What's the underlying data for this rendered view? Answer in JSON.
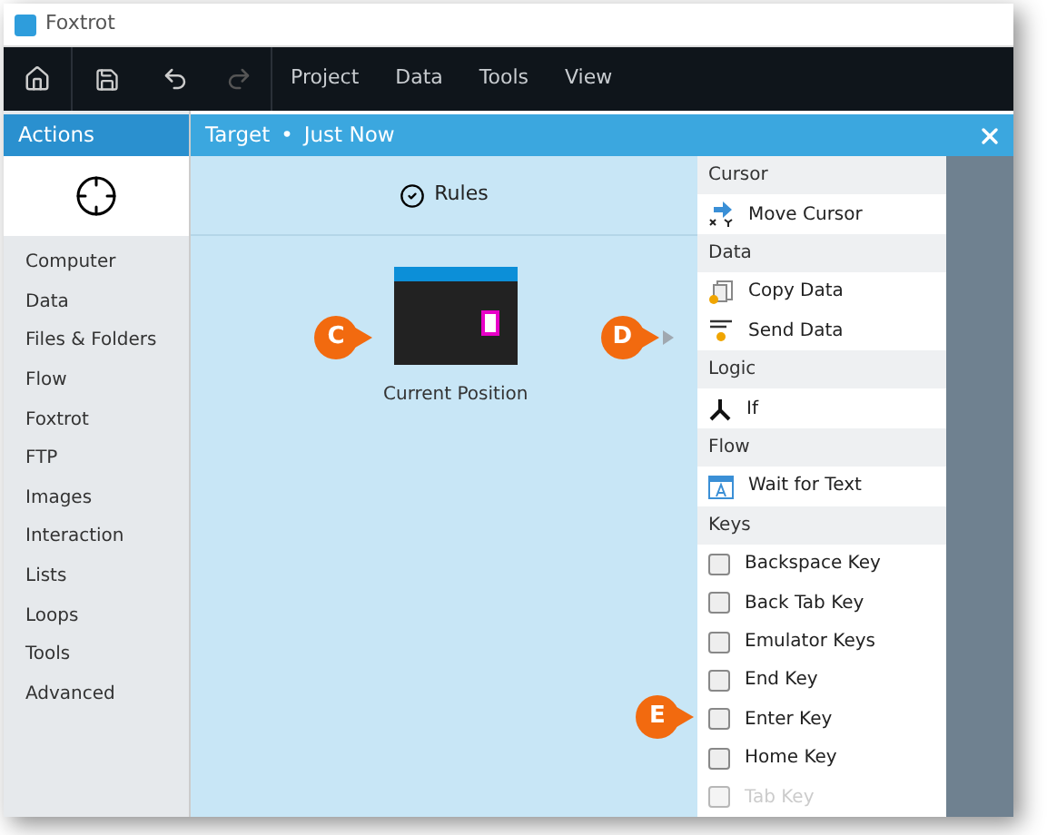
{
  "window": {
    "title": "Foxtrot"
  },
  "toolbar": {
    "menu": [
      "Project",
      "Data",
      "Tools",
      "View"
    ],
    "redo_disabled": true
  },
  "actions_panel": {
    "title": "Actions",
    "categories": [
      "Computer",
      "Data",
      "Files & Folders",
      "Flow",
      "Foxtrot",
      "FTP",
      "Images",
      "Interaction",
      "Lists",
      "Loops",
      "Tools",
      "Advanced"
    ]
  },
  "target_panel": {
    "title": "Target",
    "separator": "•",
    "time": "Just Now",
    "tab": "Rules",
    "node_label": "Current Position"
  },
  "action_list": [
    {
      "kind": "header",
      "label": "Cursor"
    },
    {
      "kind": "cursor",
      "label": "Move Cursor",
      "dimmed": false
    },
    {
      "kind": "header",
      "label": "Data"
    },
    {
      "kind": "copy",
      "label": "Copy Data",
      "dimmed": false
    },
    {
      "kind": "send",
      "label": "Send Data",
      "dimmed": false
    },
    {
      "kind": "header",
      "label": "Logic"
    },
    {
      "kind": "if",
      "label": "If",
      "dimmed": false
    },
    {
      "kind": "header",
      "label": "Flow"
    },
    {
      "kind": "wait",
      "label": "Wait for Text",
      "dimmed": false
    },
    {
      "kind": "header",
      "label": "Keys"
    },
    {
      "kind": "key",
      "label": "Backspace Key",
      "dimmed": false
    },
    {
      "kind": "key",
      "label": "Back Tab Key",
      "dimmed": false
    },
    {
      "kind": "key",
      "label": "Emulator Keys",
      "dimmed": false
    },
    {
      "kind": "key",
      "label": "End Key",
      "dimmed": false
    },
    {
      "kind": "key",
      "label": "Enter Key",
      "dimmed": false
    },
    {
      "kind": "key",
      "label": "Home Key",
      "dimmed": false
    },
    {
      "kind": "key",
      "label": "Tab Key",
      "dimmed": true
    }
  ],
  "callouts": [
    "C",
    "D",
    "E"
  ]
}
